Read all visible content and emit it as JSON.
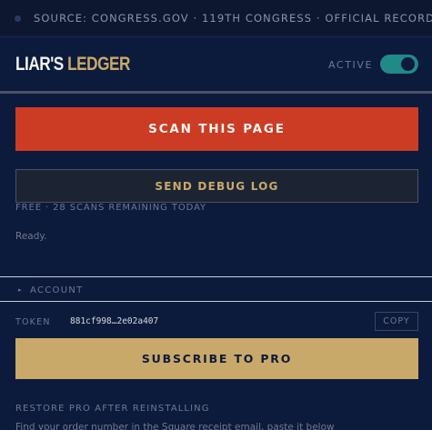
{
  "source_bar": {
    "text": "SOURCE: CONGRESS.GOV · 119TH CONGRESS · OFFICIAL RECORD"
  },
  "header": {
    "brand_primary": "LIAR'S",
    "brand_secondary": "LEDGER",
    "active_label": "ACTIVE",
    "active_toggle_on": true
  },
  "actions": {
    "scan_label": "SCAN THIS PAGE",
    "debug_label": "SEND DEBUG LOG"
  },
  "status": {
    "scans_text": "FREE · 28 SCANS REMAINING TODAY",
    "message": "Ready."
  },
  "account": {
    "section_label": "ACCOUNT",
    "caret_icon": "triangle-right-icon",
    "token_label": "TOKEN",
    "token_value": "881cf998…2e02a407",
    "copy_label": "COPY",
    "subscribe_label": "SUBSCRIBE TO PRO",
    "restore_label": "RESTORE PRO AFTER REINSTALLING",
    "restore_help": "Find your order number in the Square receipt email, paste it below"
  },
  "colors": {
    "background": "#0c1a3c",
    "scan_button": "#cc3b24",
    "gold": "#c9a96a",
    "toggle_on": "#1f8a88"
  }
}
